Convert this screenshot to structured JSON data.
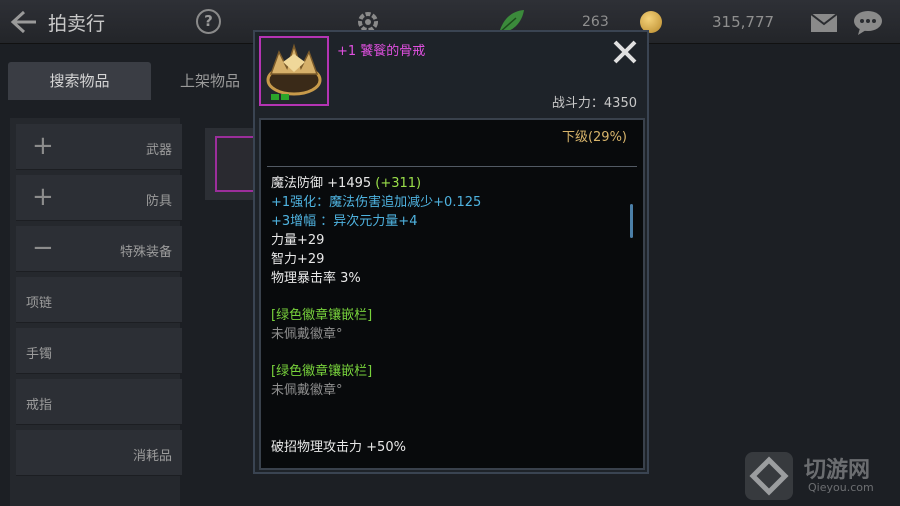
{
  "header": {
    "title": "拍卖行",
    "help_label": "?",
    "gem_count": "263",
    "gold_count": "315,777"
  },
  "tabs": [
    {
      "label": "搜索物品"
    },
    {
      "label": "上架物品"
    }
  ],
  "categories": [
    {
      "label": "武器",
      "symbol": "+"
    },
    {
      "label": "防具",
      "symbol": "+"
    },
    {
      "label": "特殊装备",
      "symbol": "−"
    },
    {
      "label": "项链"
    },
    {
      "label": "手镯"
    },
    {
      "label": "戒指"
    },
    {
      "label": "消耗品"
    }
  ],
  "popup": {
    "item_name": "+1 饕餮的骨戒",
    "power_label": "战斗力：4350",
    "grade": "下级(29%)",
    "stats": {
      "magic_def_label": "魔法防御",
      "magic_def_value": "+1495",
      "magic_def_bonus": "(+311)",
      "enhance": "+1强化：魔法伤害追加减少+0.125",
      "amplify": "+3增幅 ：异次元力量+4",
      "strength": "力量+29",
      "intelligence": "智力+29",
      "crit_label": "物理暴击率",
      "crit_value": "3%",
      "socket1_title": "[绿色徽章镶嵌栏]",
      "socket1_text": "未佩戴徽章°",
      "socket2_title": "[绿色徽章镶嵌栏]",
      "socket2_text": "未佩戴徽章°",
      "break_label": "破招物理攻击力",
      "break_value": "+50%"
    }
  },
  "watermark": {
    "title": "切游网",
    "url": "Qieyou.com"
  },
  "colors": {
    "item_name": "#e050e0",
    "grade": "#d6b36a",
    "enhance": "#4fb3e0",
    "socket": "#78d23c"
  }
}
